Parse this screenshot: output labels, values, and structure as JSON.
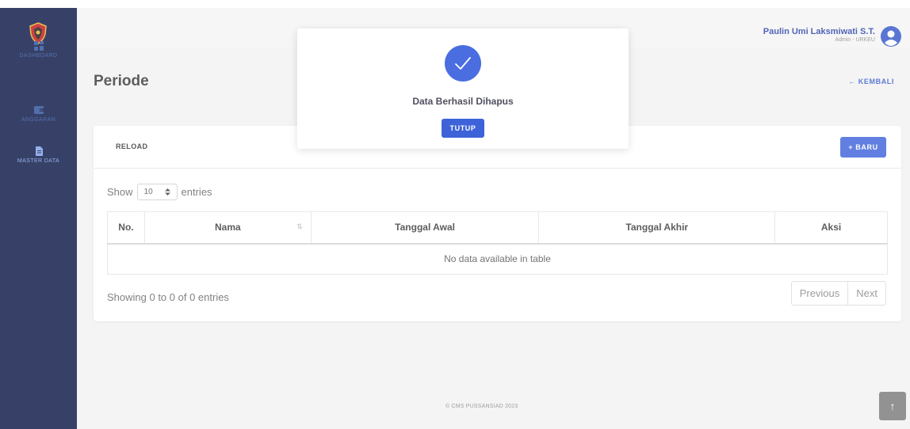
{
  "sidebar": {
    "items": [
      {
        "label": "DASHBOARD",
        "icon": "dashboard-icon"
      },
      {
        "label": "ANGGARAN",
        "icon": "wallet-icon"
      },
      {
        "label": "MASTER DATA",
        "icon": "file-icon"
      }
    ]
  },
  "header": {
    "user_name": "Paulin Umi Laksmiwati S.T.",
    "user_role": "Admin - URKEU"
  },
  "page": {
    "title": "Periode",
    "back_label": "← KEMBALI"
  },
  "card": {
    "reload_label": "RELOAD",
    "new_label": "+ BARU",
    "show_label": "Show",
    "page_length": "10",
    "entries_label": "entries",
    "columns": [
      "No.",
      "Nama",
      "Tanggal Awal",
      "Tanggal Akhir",
      "Aksi"
    ],
    "sort_icon": "⇅",
    "empty_message": "No data available in table",
    "info": "Showing 0 to 0 of 0 entries",
    "pagination": {
      "previous": "Previous",
      "next": "Next"
    }
  },
  "footer": {
    "text": "© CMS PUSSANSIAD 2023"
  },
  "scroll_top_icon": "↑",
  "modal": {
    "title": "Data Berhasil Dihapus",
    "button_label": "TUTUP"
  },
  "colors": {
    "sidebar_bg": "#0b1847",
    "accent": "#3e63d9",
    "page_bg": "#f2f2f3"
  }
}
